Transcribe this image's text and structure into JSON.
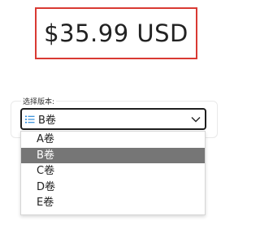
{
  "price": {
    "text": "$35.99 USD",
    "border_color": "#d93a33"
  },
  "version_select": {
    "label": "选择版本:",
    "selected": "B卷",
    "icon": "list-icon",
    "chevron_icon": "chevron-down-icon",
    "options": [
      {
        "label": "A卷",
        "selected": false
      },
      {
        "label": "B卷",
        "selected": true
      },
      {
        "label": "C卷",
        "selected": false
      },
      {
        "label": "D卷",
        "selected": false
      },
      {
        "label": "E卷",
        "selected": false
      }
    ],
    "highlight_color": "#767676",
    "icon_color": "#2f8bd8"
  }
}
